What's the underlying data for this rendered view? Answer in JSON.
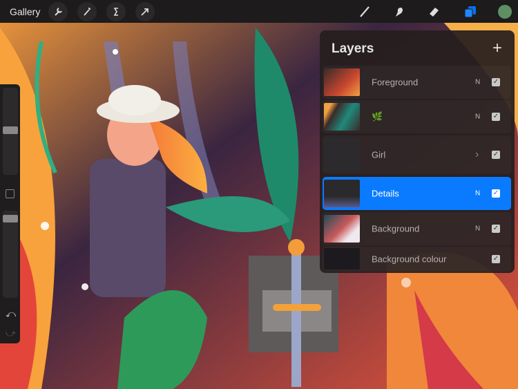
{
  "toolbar": {
    "gallery_label": "Gallery",
    "left_tools": [
      "wrench-icon",
      "magic-wand-icon",
      "selection-icon",
      "transform-arrow-icon"
    ],
    "right_tools": [
      "brush-icon",
      "smudge-icon",
      "eraser-icon",
      "layers-icon"
    ],
    "color_swatch": "#5e8f63"
  },
  "sidebar": {
    "brush_size_level": 0.45,
    "opacity_level": 0.1,
    "undo_icon": "undo-icon",
    "redo_icon": "redo-icon"
  },
  "layers_panel": {
    "title": "Layers",
    "add_icon": "plus-icon",
    "layers": [
      {
        "name": "Foreground",
        "blend": "N",
        "visible": true
      },
      {
        "name": "🌿",
        "blend": "N",
        "visible": true
      },
      {
        "name": "Girl",
        "blend": "›",
        "visible": true
      },
      {
        "name": "Details",
        "blend": "N",
        "visible": true,
        "selected": true
      },
      {
        "name": "Background",
        "blend": "N",
        "visible": true
      },
      {
        "name": "Background colour",
        "blend": "",
        "visible": true
      }
    ]
  },
  "colors": {
    "accent": "#0a7bff",
    "topbar": "#1d1b1c"
  }
}
